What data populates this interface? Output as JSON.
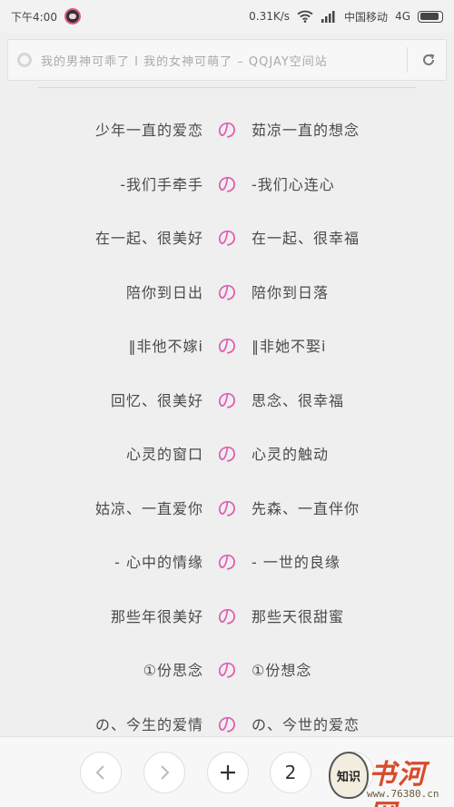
{
  "status_bar": {
    "time": "下午4:00",
    "speed": "0.31K/s",
    "carrier": "中国移动",
    "network": "4G",
    "icons": [
      "avatar-icon",
      "wifi-icon",
      "signal-icon",
      "battery-icon"
    ]
  },
  "url_bar": {
    "text": "我的男神可乖了 I 我的女神可萌了 – QQJAY空间站",
    "icons": [
      "page-loading-icon",
      "refresh-icon"
    ]
  },
  "separator": "の",
  "lines": [
    {
      "left": "少年一直的爱恋",
      "right": "茹凉一直的想念"
    },
    {
      "left": "-我们手牵手",
      "right": "-我们心连心"
    },
    {
      "left": "在一起、很美好",
      "right": "在一起、很幸福"
    },
    {
      "left": "陪你到日出",
      "right": "陪你到日落"
    },
    {
      "left": "‖非他不嫁i",
      "right": "‖非她不娶i"
    },
    {
      "left": "回忆、很美好",
      "right": "思念、很幸福"
    },
    {
      "left": "心灵的窗口",
      "right": "心灵的触动"
    },
    {
      "left": "姑凉、一直爱你",
      "right": "先森、一直伴你"
    },
    {
      "left": "- 心中的情缘",
      "right": "- 一世的良缘"
    },
    {
      "left": "那些年很美好",
      "right": "那些天很甜蜜"
    },
    {
      "left": "①份思念",
      "right": "①份想念"
    },
    {
      "left": "の、今生的爱情",
      "right": "の、今世的爱恋"
    }
  ],
  "bottom_nav": {
    "tab_count": "2",
    "icons": [
      "back-icon",
      "forward-icon",
      "plus-icon",
      "menu-icon"
    ]
  },
  "watermark": {
    "logo_text": "知识",
    "text": "书河网",
    "url": "www.76380.cn"
  },
  "colors": {
    "background": "#efefef",
    "separator": "#e05fb4",
    "watermark": "#d94a2a"
  }
}
